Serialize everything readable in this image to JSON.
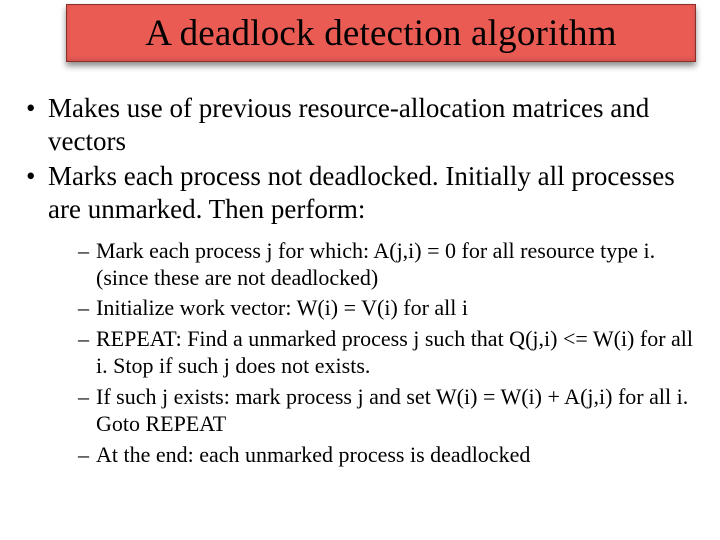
{
  "slide": {
    "title": "A deadlock detection algorithm",
    "bullets": [
      "Makes use of previous resource-allocation matrices and vectors",
      "Marks each process not deadlocked. Initially all processes are unmarked. Then perform:"
    ],
    "subbullets": [
      "Mark each process j for which: A(j,i) = 0 for all resource type i. (since these are not deadlocked)",
      "Initialize work vector: W(i) = V(i) for all i",
      "REPEAT: Find a unmarked process j such that Q(j,i) <= W(i) for all i. Stop if such j does not exists.",
      "If such j exists: mark process j and set W(i) = W(i) +  A(j,i) for all i. Goto REPEAT",
      "At the end: each unmarked process is deadlocked"
    ]
  }
}
